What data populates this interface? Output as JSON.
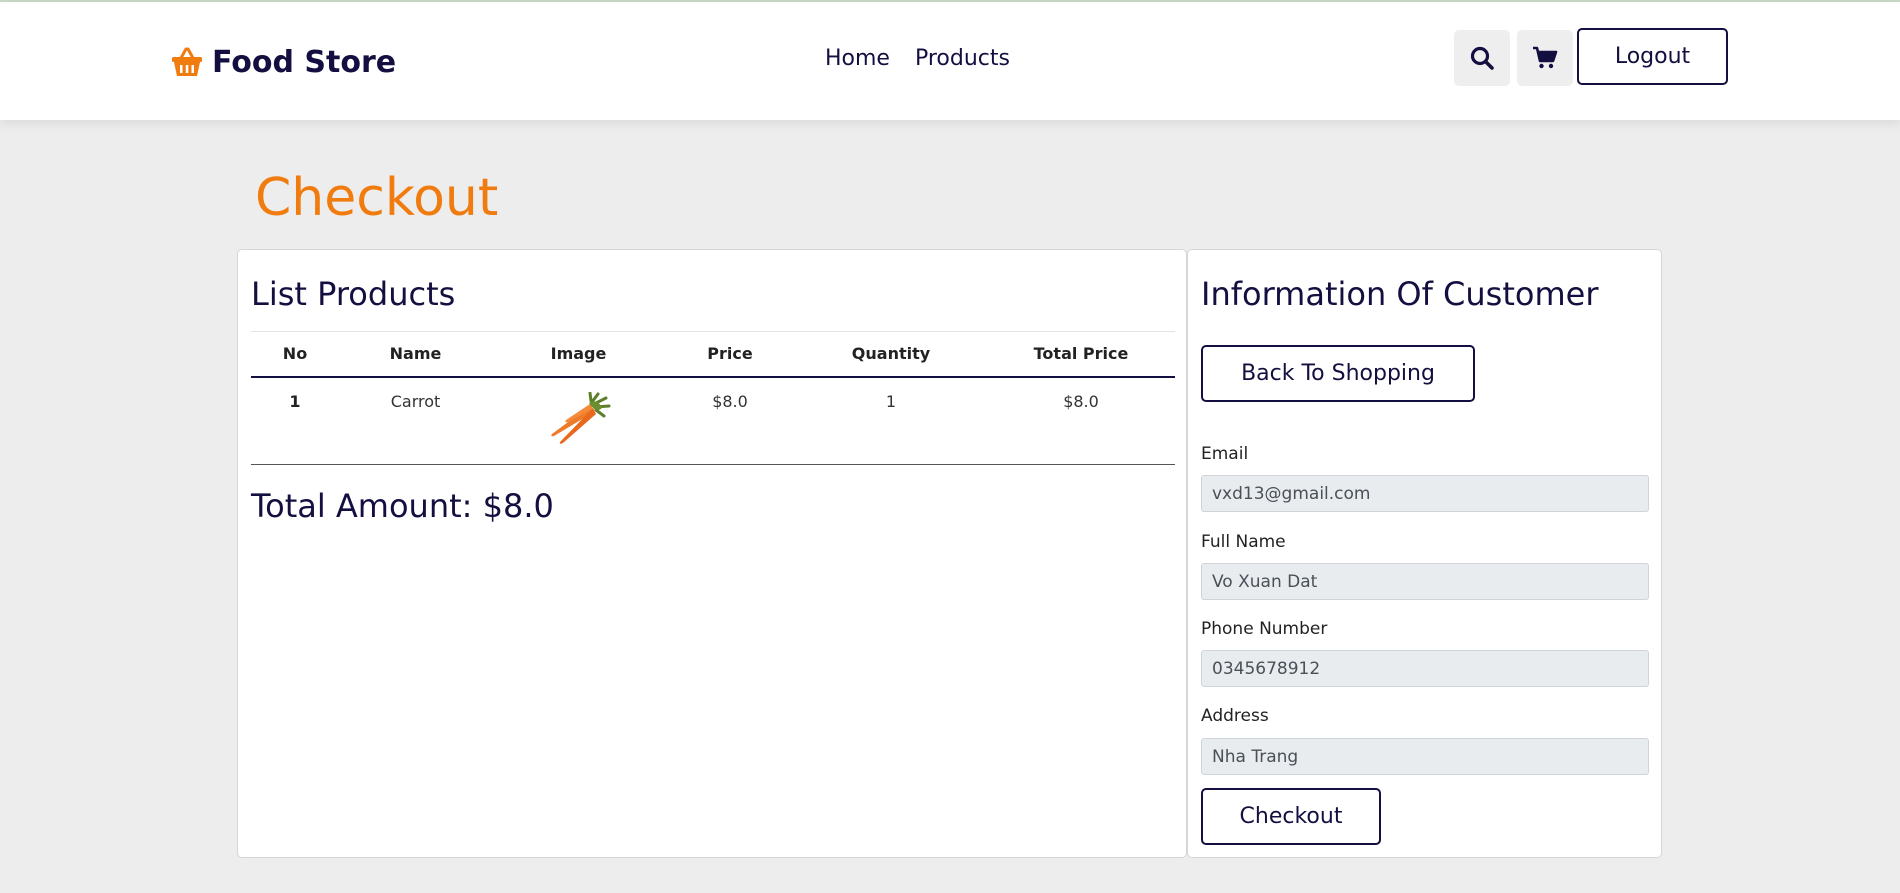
{
  "header": {
    "logo_text": "Food Store",
    "logo_icon": "basket-icon",
    "nav": {
      "home": "Home",
      "products": "Products"
    },
    "search_icon": "search-icon",
    "cart_icon": "cart-icon",
    "logout_label": "Logout"
  },
  "colors": {
    "accent": "#f07b0e",
    "primary": "#130f40",
    "background": "#ededed",
    "input_bg": "#e9ecef"
  },
  "page": {
    "title": "Checkout"
  },
  "products_panel": {
    "title": "List Products",
    "columns": [
      "No",
      "Name",
      "Image",
      "Price",
      "Quantity",
      "Total Price"
    ],
    "rows": [
      {
        "no": "1",
        "name": "Carrot",
        "image": "carrot-image",
        "price": "$8.0",
        "quantity": "1",
        "total": "$8.0"
      }
    ],
    "total_amount": "Total Amount: $8.0"
  },
  "customer_panel": {
    "title": "Information Of Customer",
    "back_label": "Back To Shopping",
    "email_label": "Email",
    "email_value": "vxd13@gmail.com",
    "fullname_label": "Full Name",
    "fullname_value": "Vo Xuan Dat",
    "phone_label": "Phone Number",
    "phone_value": "0345678912",
    "address_label": "Address",
    "address_value": "Nha Trang",
    "checkout_label": "Checkout"
  }
}
